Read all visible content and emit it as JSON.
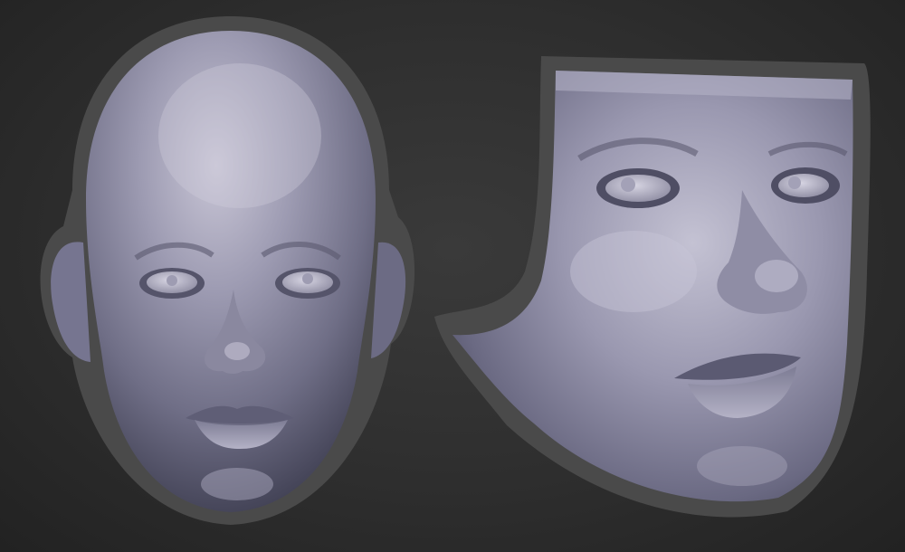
{
  "scene": {
    "background_color": "#2f2f2f",
    "halo_color": "#4a4a4a",
    "skin_color": "#8a8aa2",
    "skin_highlight": "#c9c6d6",
    "skin_shadow": "#3f3f52",
    "views": [
      {
        "view": "front",
        "subject": "sculpted-head"
      },
      {
        "view": "three-quarter",
        "subject": "sculpted-face-mask"
      }
    ]
  }
}
